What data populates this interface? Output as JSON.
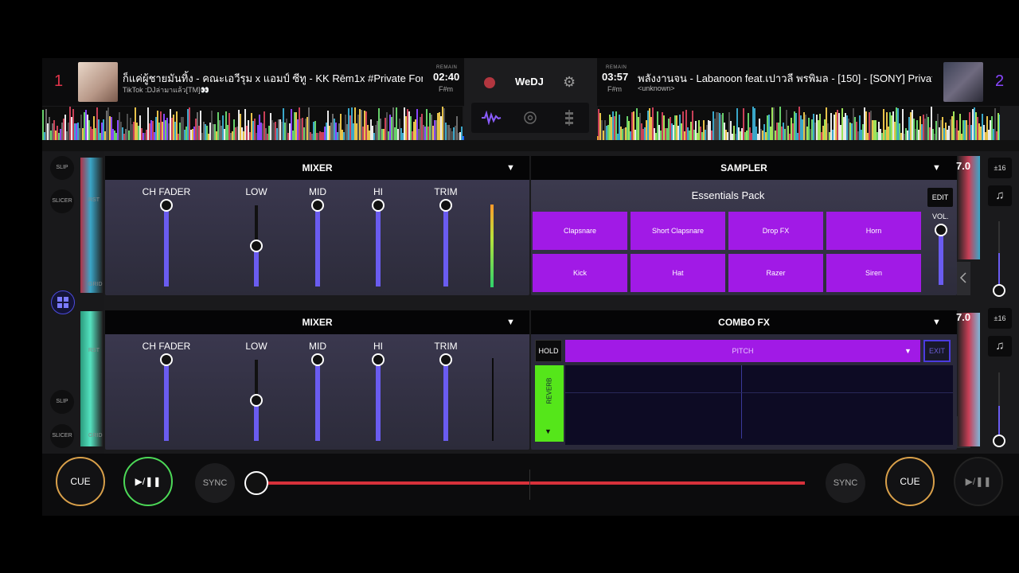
{
  "deck1": {
    "number": "1",
    "title": "ก็แค่ผู้ชายมันทิ้ง - คณะเอวีรุม x แอมป์ ซีทู - KK Rēm1x #Private For K",
    "artist": "TikTok :DJล่ามาแล้ว[TM]👀",
    "remain_label": "REMAIN",
    "remain_time": "02:40",
    "key": "F#m"
  },
  "deck2": {
    "number": "2",
    "title": "พลังงานจน - Labanoon feat.เปาวลี พรพิมล - [150] - [SONY] Private E",
    "artist": "<unknown>",
    "remain_label": "REMAIN",
    "remain_time": "03:57",
    "key": "F#m"
  },
  "center": {
    "app_name": "WeDJ"
  },
  "mixer_top": {
    "title": "MIXER",
    "controls": [
      {
        "label": "CH FADER",
        "level": 1.0
      },
      {
        "label": "LOW",
        "level": 0.5
      },
      {
        "label": "MID",
        "level": 1.0
      },
      {
        "label": "HI",
        "level": 1.0
      },
      {
        "label": "TRIM",
        "level": 1.0
      }
    ]
  },
  "mixer_bottom": {
    "title": "MIXER",
    "controls": [
      {
        "label": "CH FADER",
        "level": 1.0
      },
      {
        "label": "LOW",
        "level": 0.5
      },
      {
        "label": "MID",
        "level": 1.0
      },
      {
        "label": "HI",
        "level": 1.0
      },
      {
        "label": "TRIM",
        "level": 1.0
      }
    ]
  },
  "sampler": {
    "title": "SAMPLER",
    "pack": "Essentials Pack",
    "edit_label": "EDIT",
    "vol_label": "VOL.",
    "pads": [
      "Clapsnare",
      "Short Clapsnare",
      "Drop FX",
      "Horn",
      "Kick",
      "Hat",
      "Razer",
      "Siren"
    ]
  },
  "combo_fx": {
    "title": "COMBO FX",
    "hold_label": "HOLD",
    "fx_name": "PITCH",
    "exit_label": "EXIT",
    "reverb_label": "REVERB"
  },
  "left_controls": {
    "slip": "SLIP",
    "slicer": "SLICER",
    "rst": "RST",
    "grid": "GRID"
  },
  "right_controls": {
    "range": "±16",
    "bpm_fragment": "7.0"
  },
  "transport": {
    "cue_label": "CUE",
    "play_label": "▶/❚❚",
    "sync_label": "SYNC"
  },
  "colors": {
    "accent_purple": "#a11ae6",
    "fader_blue": "#6a5cf0",
    "cue_ring": "#d9a04a",
    "play_ring": "#4cd957",
    "crossfader_red": "#d7313a",
    "reverb_green": "#55e61a",
    "deck1_number": "#e0344a",
    "deck2_number": "#8a46ff"
  }
}
